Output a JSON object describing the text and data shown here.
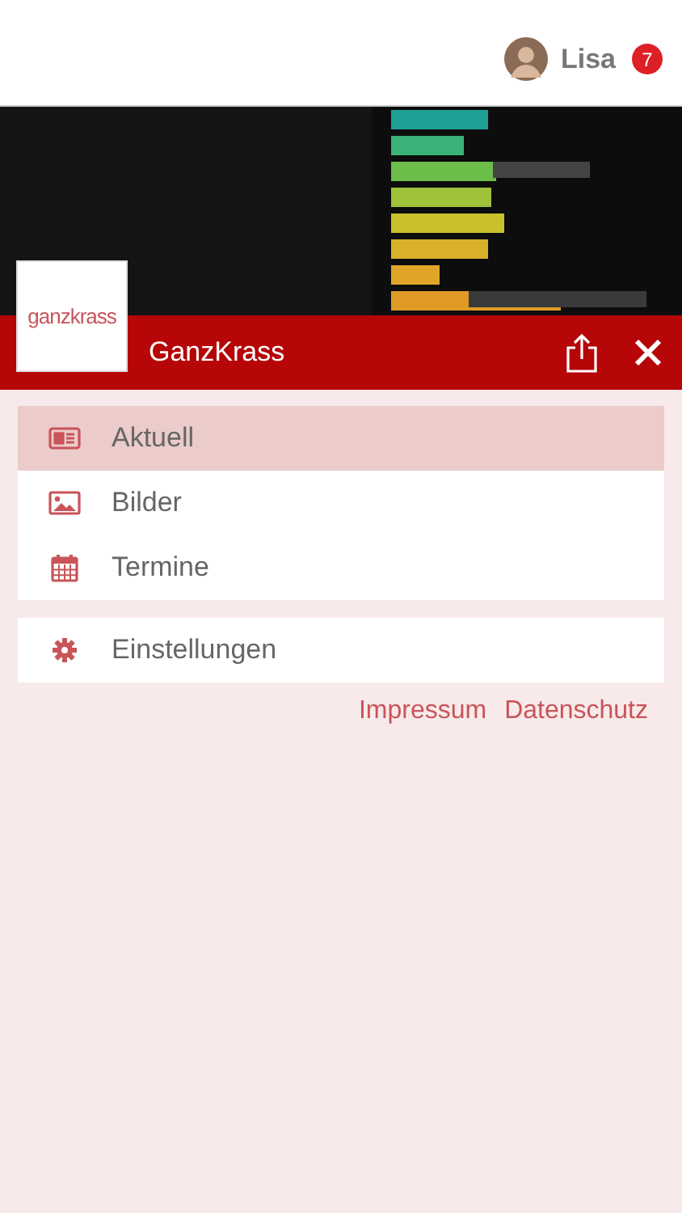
{
  "user": {
    "name": "Lisa",
    "badge": "7"
  },
  "header": {
    "logo": "ganzkrass",
    "title": "GanzKrass"
  },
  "menu_groups": [
    {
      "items": [
        {
          "label": "Aktuell",
          "selected": true
        },
        {
          "label": "Bilder",
          "selected": false
        },
        {
          "label": "Termine",
          "selected": false
        }
      ]
    },
    {
      "items": [
        {
          "label": "Einstellungen",
          "selected": false
        }
      ]
    }
  ],
  "links": [
    "Impressum",
    "Datenschutz"
  ]
}
